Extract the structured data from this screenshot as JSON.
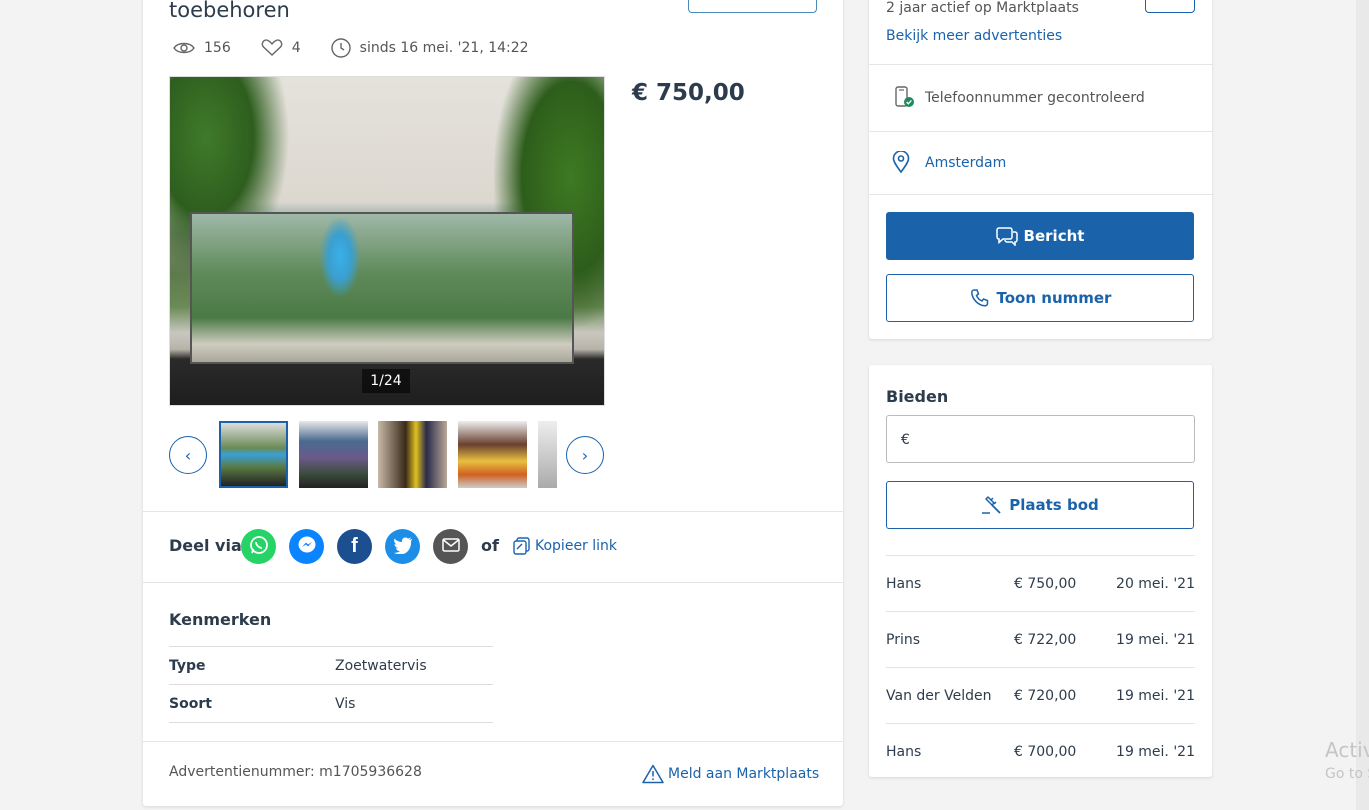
{
  "listing": {
    "title": "toebehoren",
    "views": "156",
    "favorites": "4",
    "since": "sinds 16 mei. '21, 14:22",
    "photo_counter": "1/24",
    "price": "€ 750,00"
  },
  "share": {
    "label": "Deel via",
    "of": "of",
    "copy_link": "Kopieer link"
  },
  "kenmerken": {
    "title": "Kenmerken",
    "rows": [
      {
        "key": "Type",
        "value": "Zoetwatervis"
      },
      {
        "key": "Soort",
        "value": "Vis"
      }
    ]
  },
  "footer": {
    "ad_number": "Advertentienummer: m1705936628",
    "report": "Meld aan Marktplaats"
  },
  "seller": {
    "active": "2 jaar actief op Marktplaats",
    "more_ads": "Bekijk meer advertenties",
    "phone_verified": "Telefoonnummer gecontroleerd",
    "location": "Amsterdam",
    "message_btn": "Bericht",
    "show_number_btn": "Toon nummer"
  },
  "bidding": {
    "title": "Bieden",
    "currency": "€",
    "place_bid_btn": "Plaats bod",
    "bids": [
      {
        "name": "Hans",
        "amount": "€ 750,00",
        "date": "20 mei. '21"
      },
      {
        "name": "Prins",
        "amount": "€ 722,00",
        "date": "19 mei. '21"
      },
      {
        "name": "Van der Velden",
        "amount": "€ 720,00",
        "date": "19 mei. '21"
      },
      {
        "name": "Hans",
        "amount": "€ 700,00",
        "date": "19 mei. '21"
      }
    ]
  },
  "watermark": {
    "line1": "Activ",
    "line2": "Go to S"
  },
  "colors": {
    "brand_blue": "#1a63ab",
    "whatsapp": "#25d366",
    "messenger": "#0a84ff",
    "facebook": "#1b4f8f",
    "twitter": "#1d8ee8",
    "email": "#555555"
  }
}
